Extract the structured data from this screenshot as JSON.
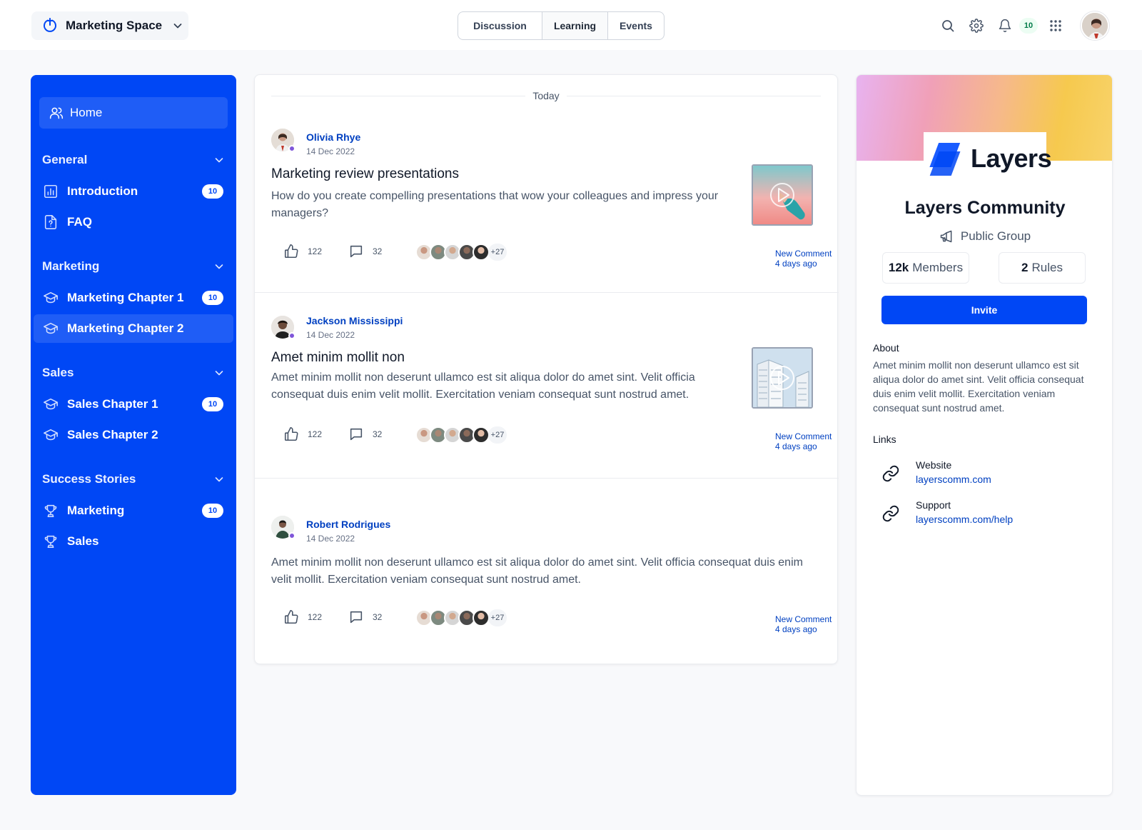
{
  "topbar": {
    "space_name": "Marketing Space",
    "tabs": [
      {
        "label": "Discussion"
      },
      {
        "label": "Learning"
      },
      {
        "label": "Events"
      }
    ],
    "active_tab": "Learning",
    "notification_count": "10"
  },
  "sidebar": {
    "home_label": "Home",
    "sections": [
      {
        "title": "General",
        "items": [
          {
            "label": "Introduction",
            "count": "10",
            "icon": "chart-icon"
          },
          {
            "label": "FAQ",
            "icon": "file-question-icon"
          }
        ]
      },
      {
        "title": "Marketing",
        "items": [
          {
            "label": "Marketing Chapter 1",
            "count": "10",
            "icon": "graduation-cap-icon"
          },
          {
            "label": "Marketing Chapter 2",
            "icon": "graduation-cap-icon",
            "active": true
          }
        ]
      },
      {
        "title": "Sales",
        "items": [
          {
            "label": "Sales Chapter 1",
            "count": "10",
            "icon": "graduation-cap-icon"
          },
          {
            "label": "Sales Chapter 2",
            "icon": "graduation-cap-icon"
          }
        ]
      },
      {
        "title": "Success Stories",
        "items": [
          {
            "label": "Marketing",
            "count": "10",
            "icon": "trophy-icon"
          },
          {
            "label": "Sales",
            "icon": "trophy-icon"
          }
        ]
      }
    ]
  },
  "feed": {
    "divider_label": "Today",
    "posts": [
      {
        "author": "Olivia Rhye",
        "date": "14 Dec 2022",
        "title": "Marketing review presentations",
        "body": "How do you create compelling presentations that wow your colleagues and impress your managers?",
        "likes": "122",
        "comments": "32",
        "more_people": "+27",
        "new_comment": "New Comment 4 days ago"
      },
      {
        "author": "Jackson Mississippi",
        "date": "14 Dec 2022",
        "title": "Amet minim mollit non",
        "body": "Amet minim mollit non deserunt ullamco est sit aliqua dolor do amet sint. Velit officia consequat duis enim velit mollit. Exercitation veniam consequat sunt nostrud amet.",
        "likes": "122",
        "comments": "32",
        "more_people": "+27",
        "new_comment": "New Comment 4 days ago"
      },
      {
        "author": "Robert Rodrigues",
        "date": "14 Dec 2022",
        "body": "Amet minim mollit non deserunt ullamco est sit aliqua dolor do amet sint. Velit officia consequat duis enim velit mollit. Exercitation veniam consequat sunt nostrud amet.",
        "likes": "122",
        "comments": "32",
        "more_people": "+27",
        "new_comment": "New Comment 4 days ago"
      }
    ]
  },
  "community": {
    "logo_text": "Layers",
    "name": "Layers Community",
    "type": "Public Group",
    "members_count": "12k",
    "members_label": "Members",
    "rules_count": "2",
    "rules_label": "Rules",
    "invite_label": "Invite",
    "about_label": "About",
    "about_text": "Amet minim mollit non deserunt ullamco est sit aliqua dolor do amet sint. Velit officia consequat duis enim velit mollit. Exercitation veniam consequat sunt nostrud amet.",
    "links_label": "Links",
    "links": [
      {
        "name": "Website",
        "url": "layerscomm.com"
      },
      {
        "name": "Support",
        "url": "layerscomm.com/help"
      }
    ]
  },
  "colors": {
    "brand": "#0047f5",
    "link": "#0040c1",
    "badge_green": "#027a48"
  }
}
